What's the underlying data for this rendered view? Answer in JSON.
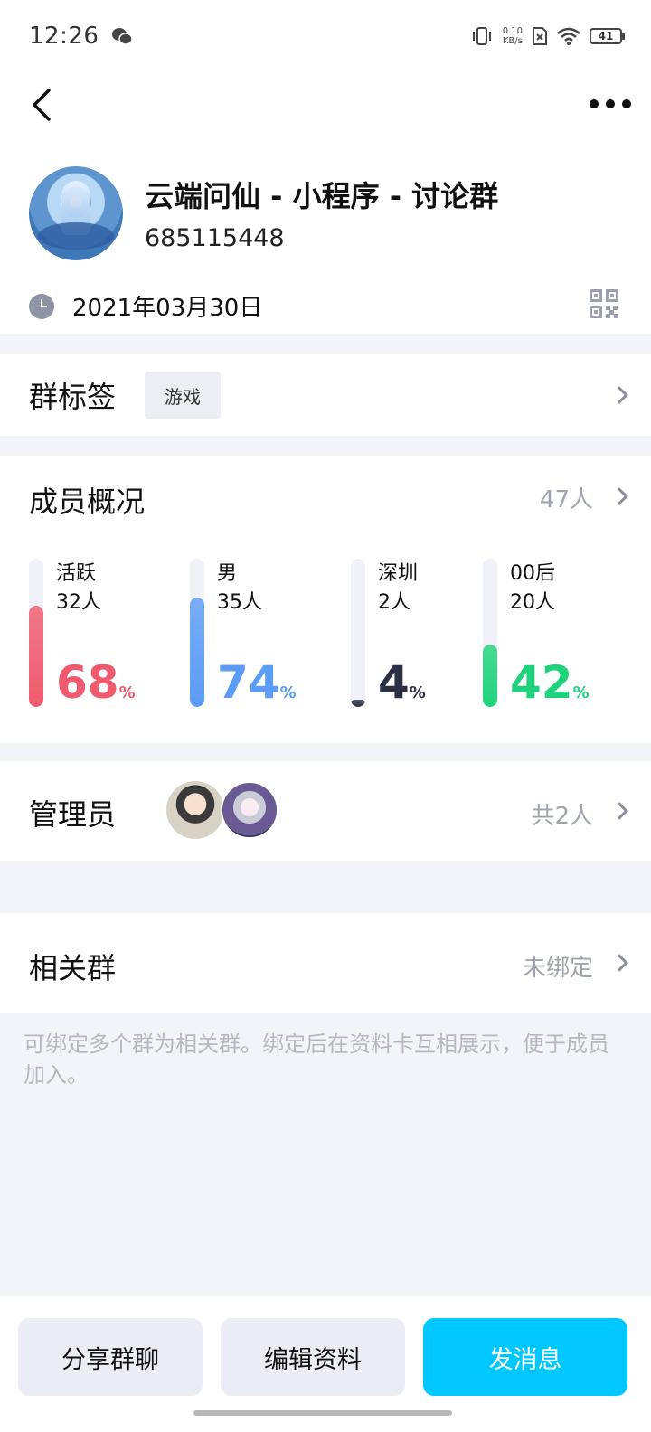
{
  "status_bar": {
    "time": "12:26",
    "net_speed_value": "0.10",
    "net_speed_unit": "KB/s",
    "battery": "41"
  },
  "group": {
    "name": "云端问仙 - 小程序 - 讨论群",
    "id": "685115448",
    "created_date": "2021年03月30日"
  },
  "tags": {
    "title": "群标签",
    "chip": "游戏"
  },
  "members": {
    "title": "成员概况",
    "total": "47人",
    "stats": [
      {
        "label": "活跃",
        "count": "32人",
        "percent": "68",
        "unit": "%",
        "fraction": 0.68,
        "color": "#f05a6e"
      },
      {
        "label": "男",
        "count": "35人",
        "percent": "74",
        "unit": "%",
        "fraction": 0.74,
        "color": "#5b9cf6"
      },
      {
        "label": "深圳",
        "count": "2人",
        "percent": "4",
        "unit": "%",
        "fraction": 0.04,
        "color": "#2b3044"
      },
      {
        "label": "00后",
        "count": "20人",
        "percent": "42",
        "unit": "%",
        "fraction": 0.42,
        "color": "#1ed37c"
      }
    ]
  },
  "admins": {
    "title": "管理员",
    "count": "共2人"
  },
  "related": {
    "title": "相关群",
    "status": "未绑定",
    "description": "可绑定多个群为相关群。绑定后在资料卡互相展示，便于成员加入。"
  },
  "actions": {
    "share": "分享群聊",
    "edit": "编辑资料",
    "send": "发消息"
  },
  "colors": {
    "accent": "#00c7ff"
  }
}
